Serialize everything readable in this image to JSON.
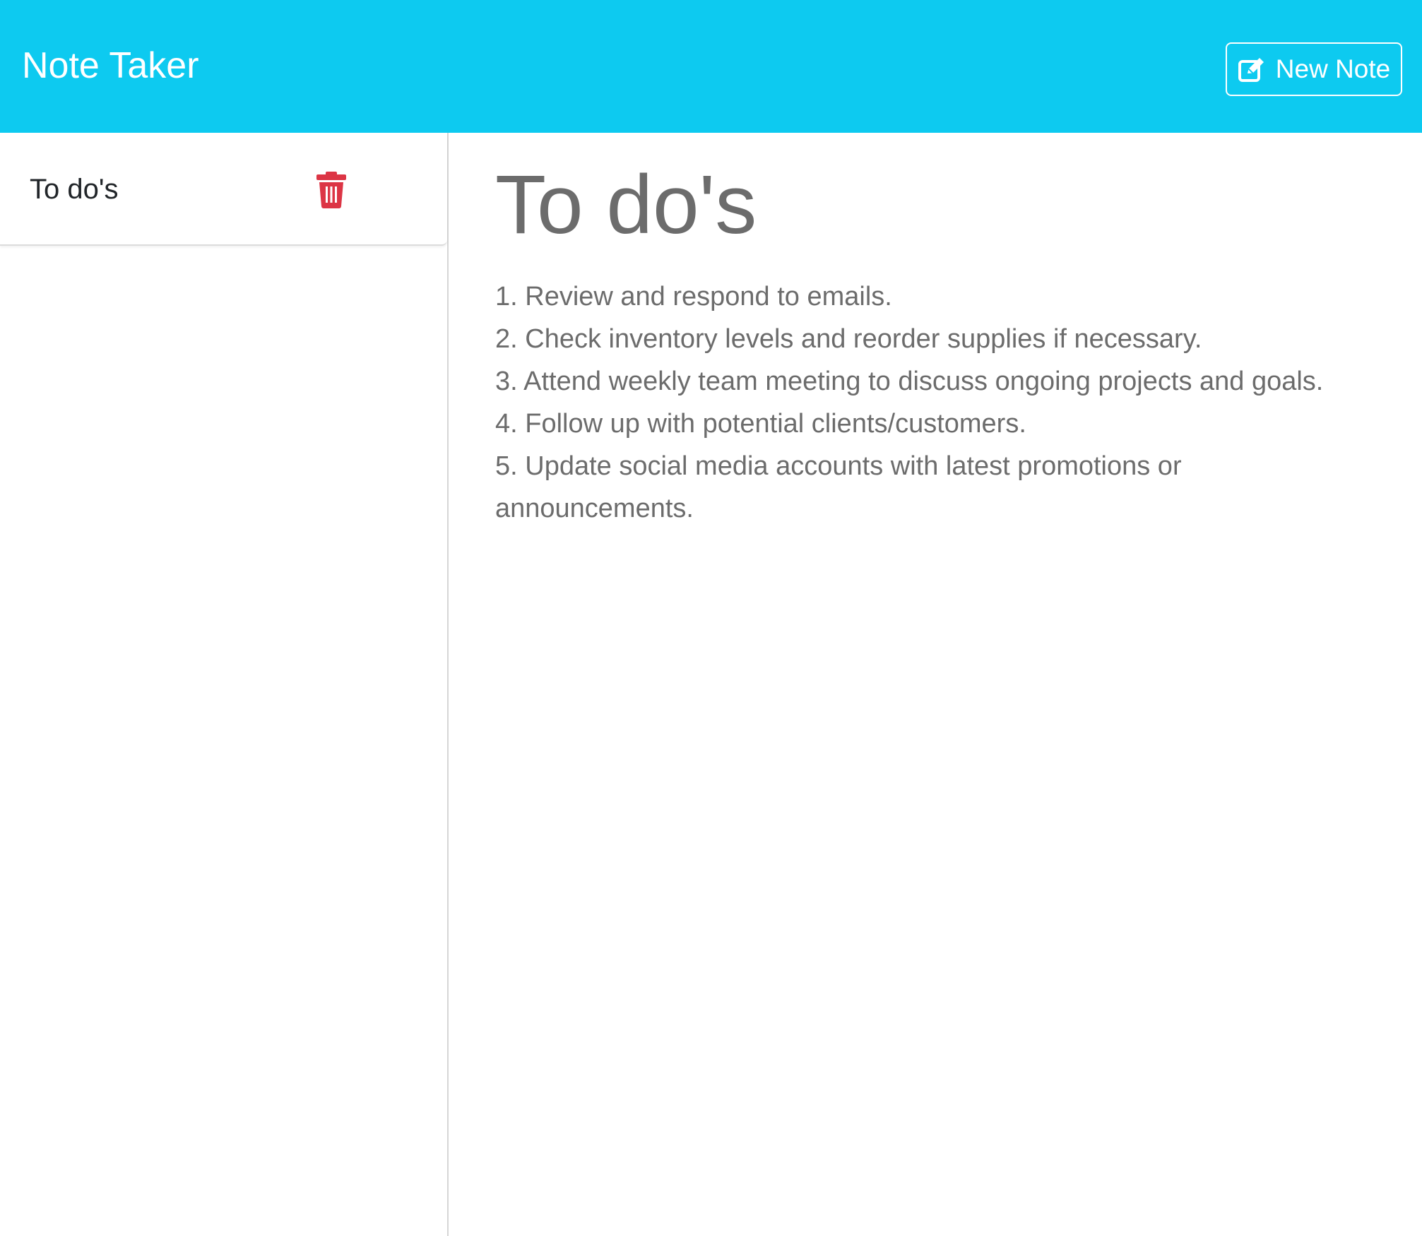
{
  "app": {
    "title": "Note Taker"
  },
  "header": {
    "new_note_label": "New Note",
    "new_note_icon": "pen-to-square-icon"
  },
  "sidebar": {
    "items": [
      {
        "title": "To do's",
        "delete_icon": "trash-icon",
        "delete_color": "#dc3545"
      }
    ]
  },
  "note": {
    "title": "To do's",
    "lines": [
      "1. Review and respond to emails.",
      "2. Check inventory levels and reorder supplies if necessary.",
      "3. Attend weekly team meeting to discuss ongoing projects and goals.",
      "4. Follow up with potential clients/customers.",
      "5. Update social media accounts with latest promotions or",
      "announcements."
    ]
  },
  "colors": {
    "navbar": "#0dcaf0",
    "danger": "#dc3545",
    "note_text": "#6c6c6c"
  }
}
